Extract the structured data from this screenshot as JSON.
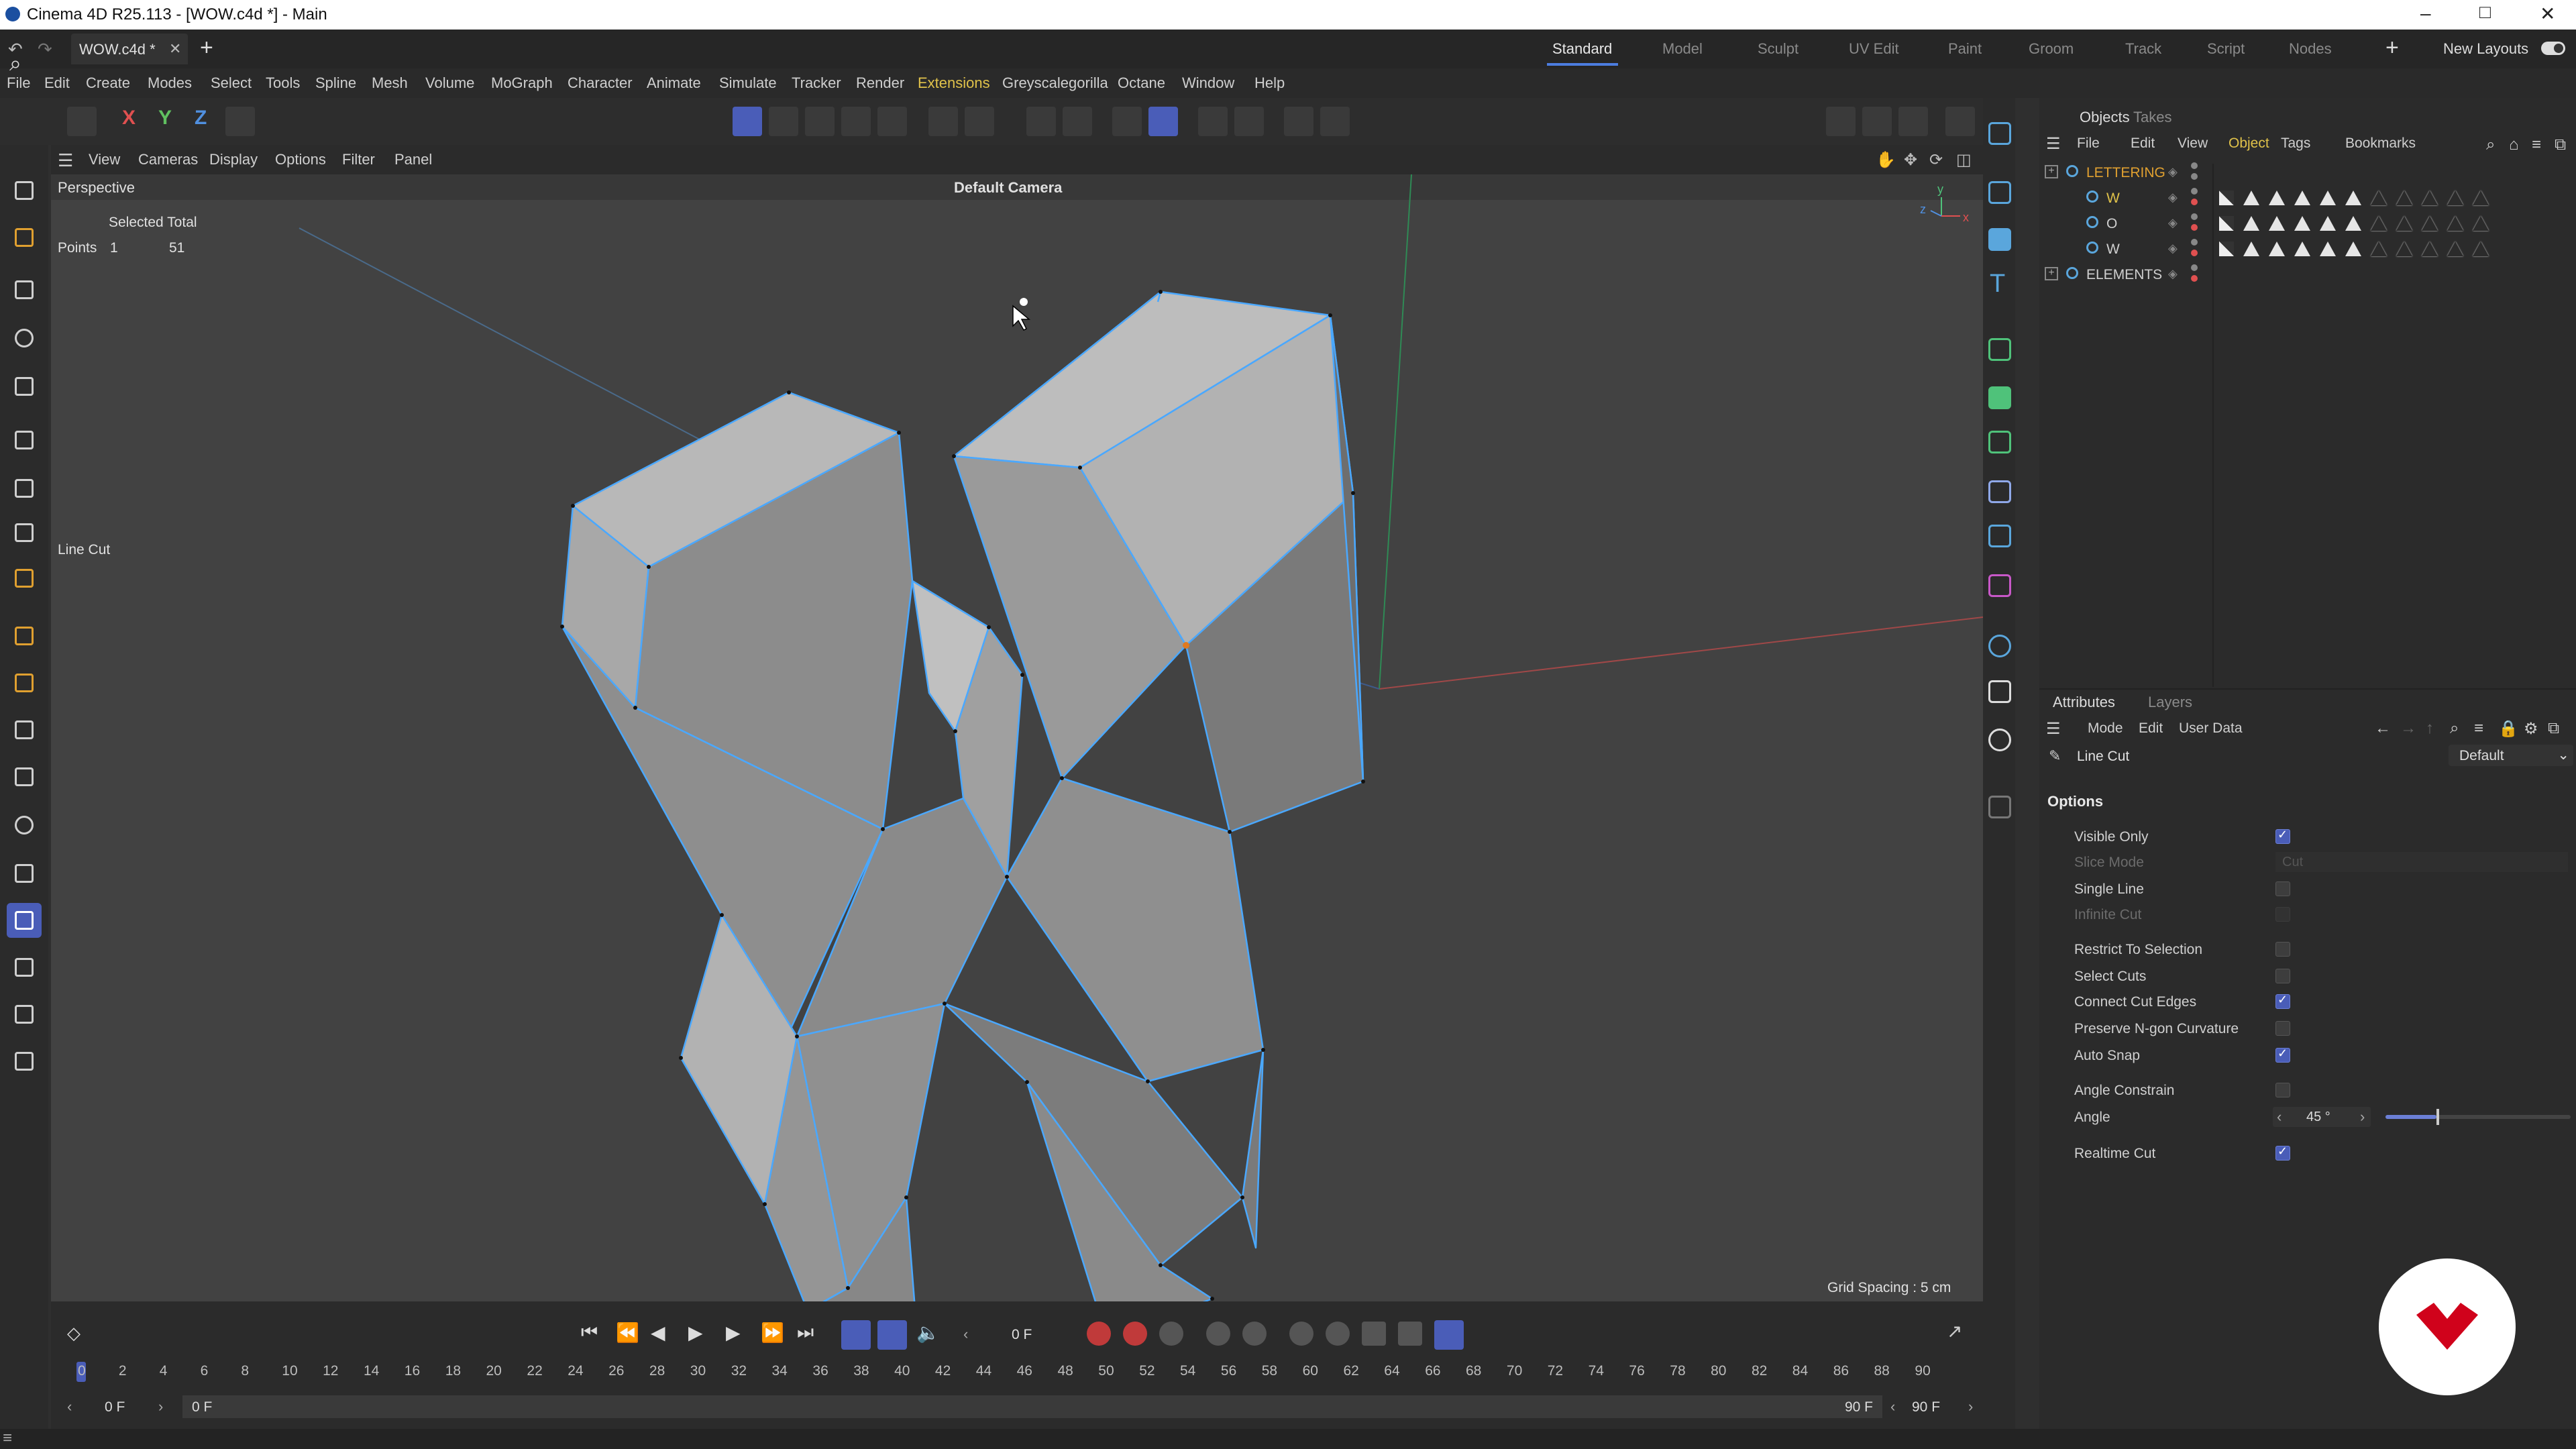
{
  "window": {
    "title": "Cinema 4D R25.113 - [WOW.c4d *] - Main"
  },
  "doc_tab": {
    "label": "WOW.c4d *"
  },
  "layouts": [
    "Standard",
    "Model",
    "Sculpt",
    "UV Edit",
    "Paint",
    "Groom",
    "Track",
    "Script",
    "Nodes"
  ],
  "new_layouts": "New Layouts",
  "menu": [
    "File",
    "Edit",
    "Create",
    "Modes",
    "Select",
    "Tools",
    "Spline",
    "Mesh",
    "Volume",
    "MoGraph",
    "Character",
    "Animate",
    "Simulate",
    "Tracker",
    "Render",
    "Extensions",
    "Greyscalegorilla",
    "Octane",
    "Window",
    "Help"
  ],
  "axes": {
    "x": "X",
    "y": "Y",
    "z": "Z"
  },
  "viewport_menu": [
    "View",
    "Cameras",
    "Display",
    "Options",
    "Filter",
    "Panel"
  ],
  "viewport": {
    "name": "Perspective",
    "camera": "Default Camera",
    "stats_header": "Selected Total",
    "stats_row_label": "Points",
    "stats_selected": "1",
    "stats_total": "51",
    "tool_label": "Line Cut",
    "grid_spacing": "Grid Spacing : 5 cm",
    "axis_y": "y",
    "axis_z": "z",
    "axis_x": "x"
  },
  "object_manager": {
    "tabs": [
      "Objects",
      "Takes"
    ],
    "menu": [
      "File",
      "Edit",
      "View",
      "Object",
      "Tags",
      "Bookmarks"
    ],
    "objects": [
      {
        "name": "LETTERING",
        "level": 0,
        "color": "#e0a030"
      },
      {
        "name": "W",
        "level": 1,
        "color": "#e0c24a"
      },
      {
        "name": "O",
        "level": 1,
        "color": "#cfcfcf"
      },
      {
        "name": "W",
        "level": 1,
        "color": "#cfcfcf"
      },
      {
        "name": "ELEMENTS",
        "level": 0,
        "color": "#cfcfcf"
      }
    ]
  },
  "attributes": {
    "tabs": [
      "Attributes",
      "Layers"
    ],
    "menu": [
      "Mode",
      "Edit",
      "User Data"
    ],
    "tool_name": "Line Cut",
    "preset": "Default",
    "section": "Options",
    "options": [
      {
        "label": "Visible Only",
        "checked": true,
        "enabled": true
      },
      {
        "label": "Slice Mode",
        "value": "Cut",
        "enabled": false
      },
      {
        "label": "Single Line",
        "checked": false,
        "enabled": true
      },
      {
        "label": "Infinite Cut",
        "checked": false,
        "enabled": false
      },
      {
        "label": "Restrict To Selection",
        "checked": false,
        "enabled": true
      },
      {
        "label": "Select Cuts",
        "checked": false,
        "enabled": true
      },
      {
        "label": "Connect Cut Edges",
        "checked": true,
        "enabled": true
      },
      {
        "label": "Preserve N-gon Curvature",
        "checked": false,
        "enabled": true
      },
      {
        "label": "Auto Snap",
        "checked": true,
        "enabled": true
      },
      {
        "label": "Angle Constrain",
        "checked": false,
        "enabled": true
      },
      {
        "label": "Angle",
        "value": "45 °",
        "enabled": true
      },
      {
        "label": "Realtime Cut",
        "checked": true,
        "enabled": true
      }
    ]
  },
  "timeline": {
    "current_frame": "0 F",
    "start": "0 F",
    "range_start": "0 F",
    "range_end": "90 F",
    "end": "90 F",
    "ruler": [
      "0",
      "2",
      "4",
      "6",
      "8",
      "10",
      "12",
      "14",
      "16",
      "18",
      "20",
      "22",
      "24",
      "26",
      "28",
      "30",
      "32",
      "34",
      "36",
      "38",
      "40",
      "42",
      "44",
      "46",
      "48",
      "50",
      "52",
      "54",
      "56",
      "58",
      "60",
      "62",
      "64",
      "66",
      "68",
      "70",
      "72",
      "74",
      "76",
      "78",
      "80",
      "82",
      "84",
      "86",
      "88",
      "90"
    ]
  },
  "colors": {
    "accent": "#4a5db8",
    "selection_edge": "#4aa8ff",
    "logo": "#d0021b"
  }
}
